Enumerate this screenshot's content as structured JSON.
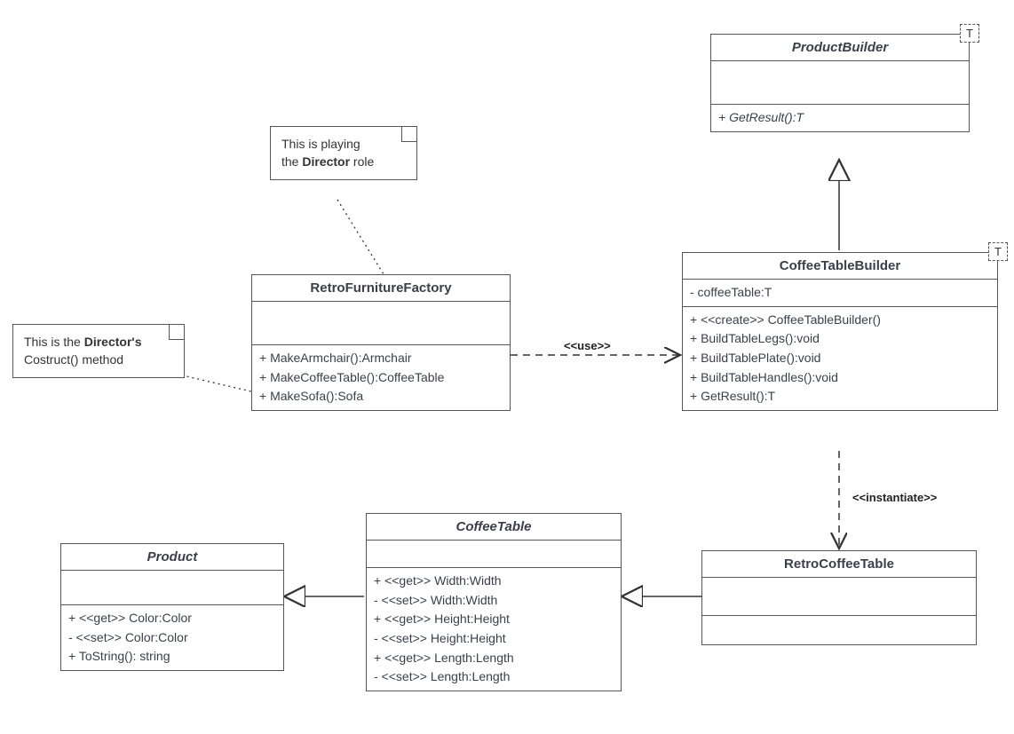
{
  "notes": {
    "director_role": {
      "line1": "This is playing",
      "line2_pre": "the ",
      "line2_bold": "Director",
      "line2_post": " role"
    },
    "construct_method": {
      "line1_pre": "This is the ",
      "line1_bold": "Director's",
      "line2": "Costruct() method"
    }
  },
  "classes": {
    "productBuilder": {
      "name": "ProductBuilder",
      "tparam": "T",
      "ops": [
        "+ GetResult():T"
      ]
    },
    "coffeeTableBuilder": {
      "name": "CoffeeTableBuilder",
      "tparam": "T",
      "attrs": [
        "- coffeeTable:T"
      ],
      "ops": [
        "+ <<create>> CoffeeTableBuilder()",
        "+ BuildTableLegs():void",
        "+ BuildTablePlate():void",
        "+ BuildTableHandles():void",
        "+ GetResult():T"
      ]
    },
    "retroFurnitureFactory": {
      "name": "RetroFurnitureFactory",
      "ops": [
        "+ MakeArmchair():Armchair",
        "+ MakeCoffeeTable():CoffeeTable",
        "+ MakeSofa():Sofa"
      ]
    },
    "retroCoffeeTable": {
      "name": "RetroCoffeeTable"
    },
    "coffeeTable": {
      "name": "CoffeeTable",
      "ops": [
        "+ <<get>> Width:Width",
        "- <<set>> Width:Width",
        "+ <<get>> Height:Height",
        "- <<set>> Height:Height",
        "+ <<get>> Length:Length",
        "- <<set>> Length:Length"
      ]
    },
    "product": {
      "name": "Product",
      "ops": [
        "+ <<get>> Color:Color",
        "- <<set>> Color:Color",
        "+ ToString(): string"
      ]
    }
  },
  "edgeLabels": {
    "use": "<<use>>",
    "instantiate": "<<instantiate>>"
  }
}
